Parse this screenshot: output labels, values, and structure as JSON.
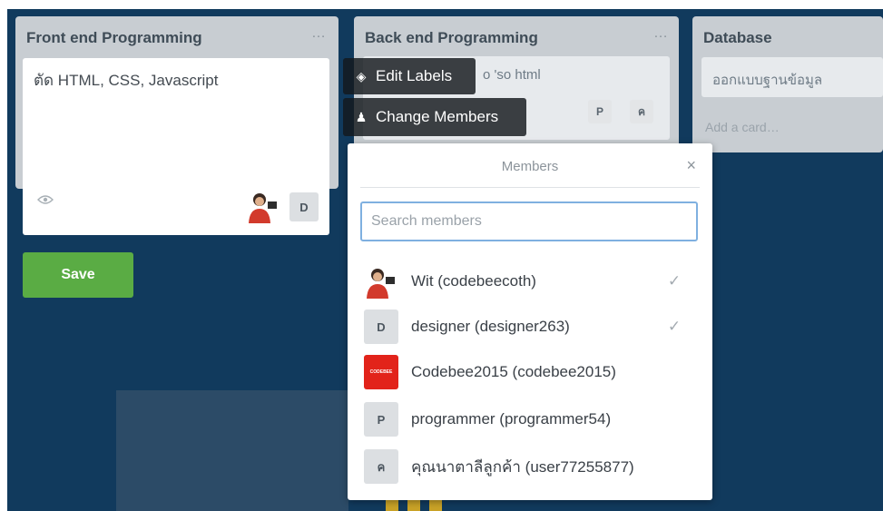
{
  "lists": [
    {
      "title": "Front end Programming",
      "menu": "…"
    },
    {
      "title": "Back end Programming",
      "menu": "…",
      "card_text": "o 'so html"
    },
    {
      "title": "Database",
      "card_text": "ออกแบบฐานข้อมูล",
      "add_card": "Add a card…"
    }
  ],
  "card_editor": {
    "text": "ตัด HTML, CSS, Javascript",
    "member_initial": "D",
    "save_label": "Save"
  },
  "back_card_tags": [
    "P",
    "ค"
  ],
  "actions": {
    "edit_labels": "Edit Labels",
    "change_members": "Change Members"
  },
  "members_popover": {
    "title": "Members",
    "close": "×",
    "search_placeholder": "Search members",
    "members": [
      {
        "name": "Wit (codebeecoth)",
        "avatar": "photo",
        "checked": "✓"
      },
      {
        "name": "designer (designer263)",
        "avatar": "D",
        "checked": "✓"
      },
      {
        "name": "Codebee2015 (codebee2015)",
        "avatar": "logo",
        "checked": ""
      },
      {
        "name": "programmer (programmer54)",
        "avatar": "P",
        "checked": ""
      },
      {
        "name": "คุณนาตาลีลูกค้า (user77255877)",
        "avatar": "ค",
        "checked": ""
      }
    ]
  },
  "colors": {
    "board_bg": "#113a5d",
    "save_green": "#5aac44",
    "codebee_red": "#e2231a"
  }
}
